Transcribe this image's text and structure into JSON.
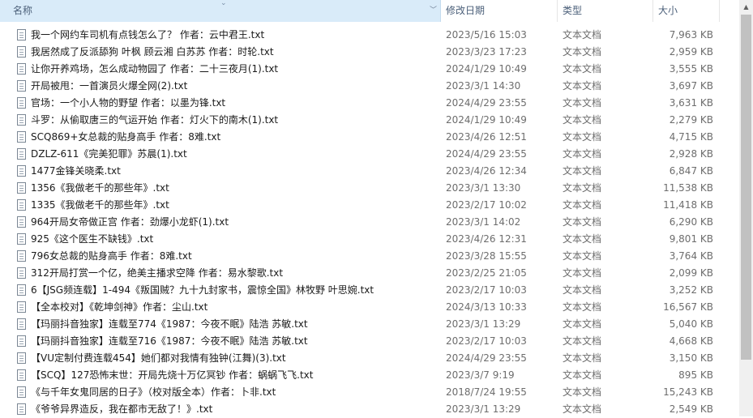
{
  "header": {
    "name_label": "名称",
    "date_label": "修改日期",
    "type_label": "类型",
    "size_label": "大小",
    "sort_indicator": "⌄"
  },
  "icons": {
    "file": "text-file-icon",
    "scroll_up": "chevron-up-icon"
  },
  "files": [
    {
      "name": "我一个网约车司机有点钱怎么了？ 作者：云中君王.txt",
      "date": "2023/5/16 15:03",
      "type": "文本文档",
      "size": "7,963 KB"
    },
    {
      "name": "我居然成了反派舔狗 叶枫 顾云湘 白苏苏  作者：时轮.txt",
      "date": "2023/3/23 17:23",
      "type": "文本文档",
      "size": "2,959 KB"
    },
    {
      "name": "让你开养鸡场，怎么成动物园了 作者：二十三夜月(1).txt",
      "date": "2024/1/29 10:49",
      "type": "文本文档",
      "size": "3,555 KB"
    },
    {
      "name": "开局被甩：一首演员火爆全网(2).txt",
      "date": "2023/3/1 14:30",
      "type": "文本文档",
      "size": "3,697 KB"
    },
    {
      "name": "官场：一个小人物的野望 作者：以墨为锋.txt",
      "date": "2024/4/29 23:55",
      "type": "文本文档",
      "size": "3,631 KB"
    },
    {
      "name": "斗罗：从偷取唐三的气运开始 作者：灯火下的南木(1).txt",
      "date": "2024/1/29 10:49",
      "type": "文本文档",
      "size": "2,279 KB"
    },
    {
      "name": "SCQ869+女总裁的贴身高手 作者：8难.txt",
      "date": "2023/4/26 12:51",
      "type": "文本文档",
      "size": "4,715 KB"
    },
    {
      "name": "DZLZ-611《完美犯罪》苏晨(1).txt",
      "date": "2024/4/29 23:55",
      "type": "文本文档",
      "size": "2,928 KB"
    },
    {
      "name": "1477金锋关晓柔.txt",
      "date": "2023/4/26 12:34",
      "type": "文本文档",
      "size": "6,847 KB"
    },
    {
      "name": "1356《我做老千的那些年》.txt",
      "date": "2023/3/1 13:30",
      "type": "文本文档",
      "size": "11,538 KB"
    },
    {
      "name": "1335《我做老千的那些年》.txt",
      "date": "2023/2/17 10:02",
      "type": "文本文档",
      "size": "11,418 KB"
    },
    {
      "name": "964开局女帝做正宫 作者：劲爆小龙虾(1).txt",
      "date": "2023/3/1 14:02",
      "type": "文本文档",
      "size": "6,290 KB"
    },
    {
      "name": "925《这个医生不缺钱》.txt",
      "date": "2023/4/26 12:31",
      "type": "文本文档",
      "size": "9,801 KB"
    },
    {
      "name": "796女总裁的贴身高手 作者：8难.txt",
      "date": "2023/3/28 15:55",
      "type": "文本文档",
      "size": "3,764 KB"
    },
    {
      "name": "312开局打赏一个亿，绝美主播求空降 作者：易水黎歌.txt",
      "date": "2023/2/25 21:05",
      "type": "文本文档",
      "size": "2,099 KB"
    },
    {
      "name": "6【JSG频连载】1-494《叛国贼？九十九封家书，震惊全国》林牧野 叶思婉.txt",
      "date": "2023/2/17 10:03",
      "type": "文本文档",
      "size": "3,252 KB"
    },
    {
      "name": "【全本校对】《乾坤剑神》作者：尘山.txt",
      "date": "2024/3/13 10:33",
      "type": "文本文档",
      "size": "16,567 KB"
    },
    {
      "name": "【玛丽抖音独家】连载至774《1987：今夜不眠》陆浩 苏敏.txt",
      "date": "2023/3/1 13:29",
      "type": "文本文档",
      "size": "5,040 KB"
    },
    {
      "name": "【玛丽抖音独家】连载至716《1987：今夜不眠》陆浩 苏敏.txt",
      "date": "2023/2/17 10:03",
      "type": "文本文档",
      "size": "4,668 KB"
    },
    {
      "name": "【VU定制付费连载454】她们都对我情有独钟(江舞)(3).txt",
      "date": "2024/4/29 23:55",
      "type": "文本文档",
      "size": "3,150 KB"
    },
    {
      "name": "【SCQ】127恐怖末世：开局先烧十万亿冥钞 作者：蜗蜗飞飞.txt",
      "date": "2023/3/7 9:19",
      "type": "文本文档",
      "size": "895 KB"
    },
    {
      "name": "《与千年女鬼同居的日子》（校对版全本）作者：卜非.txt",
      "date": "2018/7/24 19:55",
      "type": "文本文档",
      "size": "15,243 KB"
    },
    {
      "name": "《爷爷异界造反，我在都市无敌了！》.txt",
      "date": "2023/3/1 13:29",
      "type": "文本文档",
      "size": "2,549 KB"
    }
  ]
}
